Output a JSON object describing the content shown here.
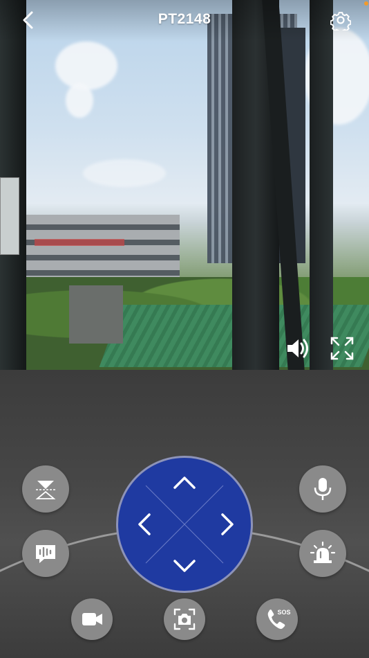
{
  "header": {
    "title": "PT2148",
    "back_icon": "chevron-left-icon",
    "settings_icon": "gear-icon"
  },
  "video": {
    "volume_icon": "speaker-icon",
    "fullscreen_icon": "fullscreen-icon"
  },
  "controls": {
    "ptz_up_icon": "chevron-up-icon",
    "ptz_down_icon": "chevron-down-icon",
    "ptz_left_icon": "chevron-left-icon",
    "ptz_right_icon": "chevron-right-icon",
    "left_top_icon": "flip-icon",
    "left_mid_icon": "voice-message-icon",
    "right_top_icon": "microphone-icon",
    "right_mid_icon": "alarm-siren-icon",
    "bottom_left_icon": "video-record-icon",
    "bottom_center_icon": "snapshot-icon",
    "bottom_right_icon": "sos-call-icon",
    "sos_label": "SOS"
  },
  "colors": {
    "dpad": "#1f3aa1",
    "button": "#8a8a8a",
    "status_dot": "#f39a2b"
  }
}
